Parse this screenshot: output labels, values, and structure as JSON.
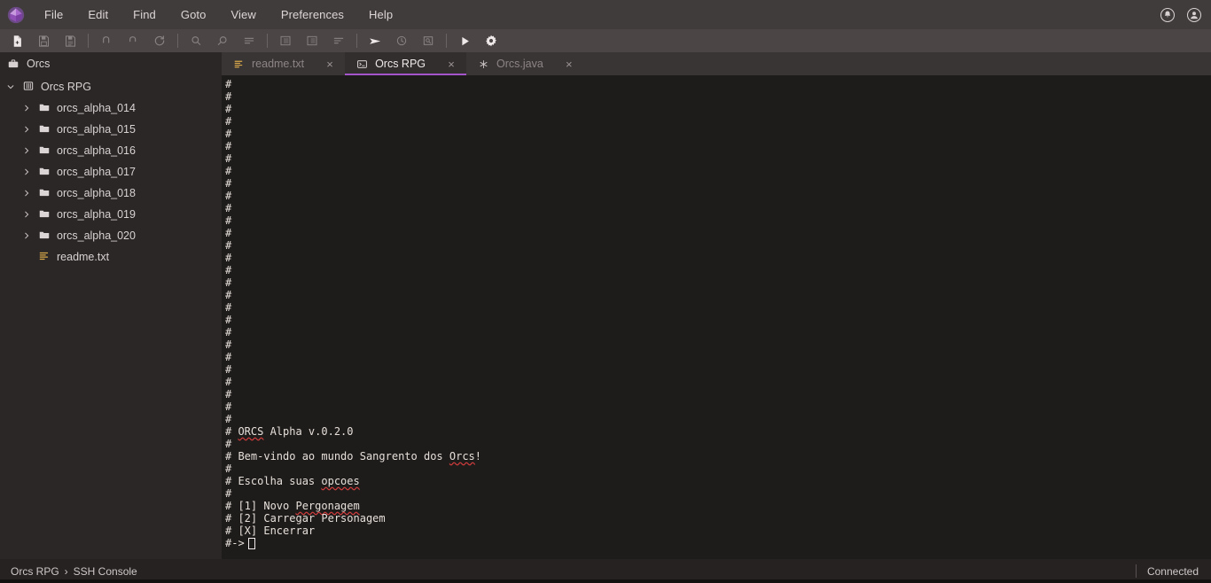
{
  "app": {
    "logo_icon": "gem-logo-icon",
    "accent_color": "#a455c9"
  },
  "menubar": {
    "items": [
      {
        "label": "File"
      },
      {
        "label": "Edit"
      },
      {
        "label": "Find"
      },
      {
        "label": "Goto"
      },
      {
        "label": "View"
      },
      {
        "label": "Preferences"
      },
      {
        "label": "Help"
      }
    ],
    "right_icons": [
      {
        "name": "notifications-bell-icon"
      },
      {
        "name": "account-avatar-icon"
      }
    ]
  },
  "toolbar": {
    "groups": [
      [
        {
          "name": "new-file-icon",
          "enabled": true
        },
        {
          "name": "save-file-icon",
          "enabled": false
        },
        {
          "name": "save-all-icon",
          "enabled": false
        }
      ],
      [
        {
          "name": "undo-icon",
          "enabled": false
        },
        {
          "name": "redo-icon",
          "enabled": false
        },
        {
          "name": "refresh-icon",
          "enabled": false
        }
      ],
      [
        {
          "name": "zoom-in-icon",
          "enabled": false
        },
        {
          "name": "zoom-out-icon",
          "enabled": false
        },
        {
          "name": "wrap-lines-icon",
          "enabled": false
        }
      ],
      [
        {
          "name": "indent-icon",
          "enabled": false
        },
        {
          "name": "outdent-icon",
          "enabled": false
        },
        {
          "name": "align-left-icon",
          "enabled": false
        }
      ],
      [
        {
          "name": "send-icon",
          "enabled": true
        },
        {
          "name": "history-icon",
          "enabled": false
        },
        {
          "name": "search-document-icon",
          "enabled": false
        }
      ],
      [
        {
          "name": "run-play-icon",
          "enabled": true
        },
        {
          "name": "settings-gear-icon",
          "enabled": true
        }
      ]
    ]
  },
  "sidebar": {
    "header": {
      "icon": "briefcase-icon",
      "label": "Orcs"
    },
    "tree": [
      {
        "label": "Orcs RPG",
        "icon": "project-icon",
        "level": "root",
        "expanded": true,
        "chevron": "chevron-down-icon"
      },
      {
        "label": "orcs_alpha_014",
        "icon": "folder-icon",
        "level": "child",
        "expanded": false,
        "chevron": "chevron-right-icon"
      },
      {
        "label": "orcs_alpha_015",
        "icon": "folder-icon",
        "level": "child",
        "expanded": false,
        "chevron": "chevron-right-icon"
      },
      {
        "label": "orcs_alpha_016",
        "icon": "folder-icon",
        "level": "child",
        "expanded": false,
        "chevron": "chevron-right-icon"
      },
      {
        "label": "orcs_alpha_017",
        "icon": "folder-icon",
        "level": "child",
        "expanded": false,
        "chevron": "chevron-right-icon"
      },
      {
        "label": "orcs_alpha_018",
        "icon": "folder-icon",
        "level": "child",
        "expanded": false,
        "chevron": "chevron-right-icon"
      },
      {
        "label": "orcs_alpha_019",
        "icon": "folder-icon",
        "level": "child",
        "expanded": false,
        "chevron": "chevron-right-icon"
      },
      {
        "label": "orcs_alpha_020",
        "icon": "folder-icon",
        "level": "child",
        "expanded": false,
        "chevron": "chevron-right-icon"
      },
      {
        "label": "readme.txt",
        "icon": "text-file-icon",
        "level": "leaf",
        "expanded": false,
        "chevron": ""
      }
    ]
  },
  "tabs": [
    {
      "label": "readme.txt",
      "icon": "text-file-icon",
      "active": false,
      "close": "×"
    },
    {
      "label": "Orcs RPG",
      "icon": "terminal-icon",
      "active": true,
      "close": "×"
    },
    {
      "label": "Orcs.java",
      "icon": "java-file-icon",
      "active": false,
      "close": "×"
    }
  ],
  "console": {
    "blank_prefix_lines": 28,
    "blank_line_text": "#",
    "lines": [
      {
        "text": "# ORCS Alpha v.0.2.0",
        "misspelled": [
          "ORCS"
        ]
      },
      {
        "text": "#",
        "misspelled": []
      },
      {
        "text": "# Bem-vindo ao mundo Sangrento dos Orcs!",
        "misspelled": [
          "Orcs"
        ]
      },
      {
        "text": "#",
        "misspelled": []
      },
      {
        "text": "# Escolha suas opcoes",
        "misspelled": [
          "opcoes"
        ]
      },
      {
        "text": "#",
        "misspelled": []
      },
      {
        "text": "# [1] Novo Pergonagem",
        "misspelled": [
          "Pergonagem"
        ]
      },
      {
        "text": "# [2] Carregar Personagem",
        "misspelled": []
      },
      {
        "text": "# [X] Encerrar",
        "misspelled": []
      }
    ],
    "prompt": "#->",
    "cursor": "block-cursor"
  },
  "statusbar": {
    "breadcrumb_project": "Orcs RPG",
    "breadcrumb_sep": "›",
    "breadcrumb_item": "SSH Console",
    "connection_status": "Connected"
  }
}
